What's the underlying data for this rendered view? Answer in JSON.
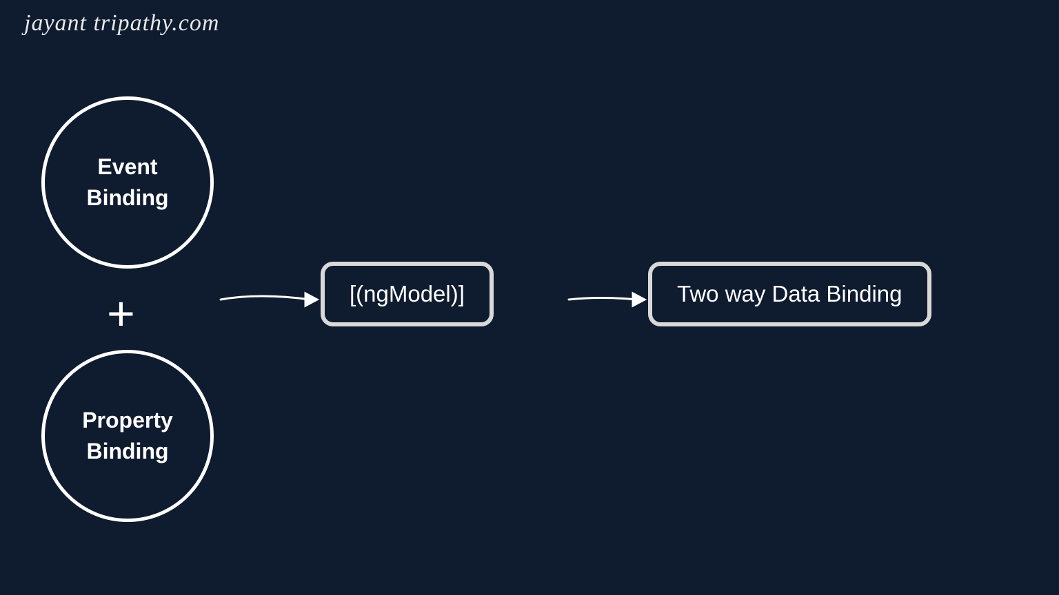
{
  "watermark": "jayant tripathy.com",
  "nodes": {
    "eventBinding": "Event\nBinding",
    "propertyBinding": "Property\nBinding",
    "ngModel": "[(ngModel)]",
    "twoWayBinding": "Two way Data Binding"
  },
  "operator": "+"
}
